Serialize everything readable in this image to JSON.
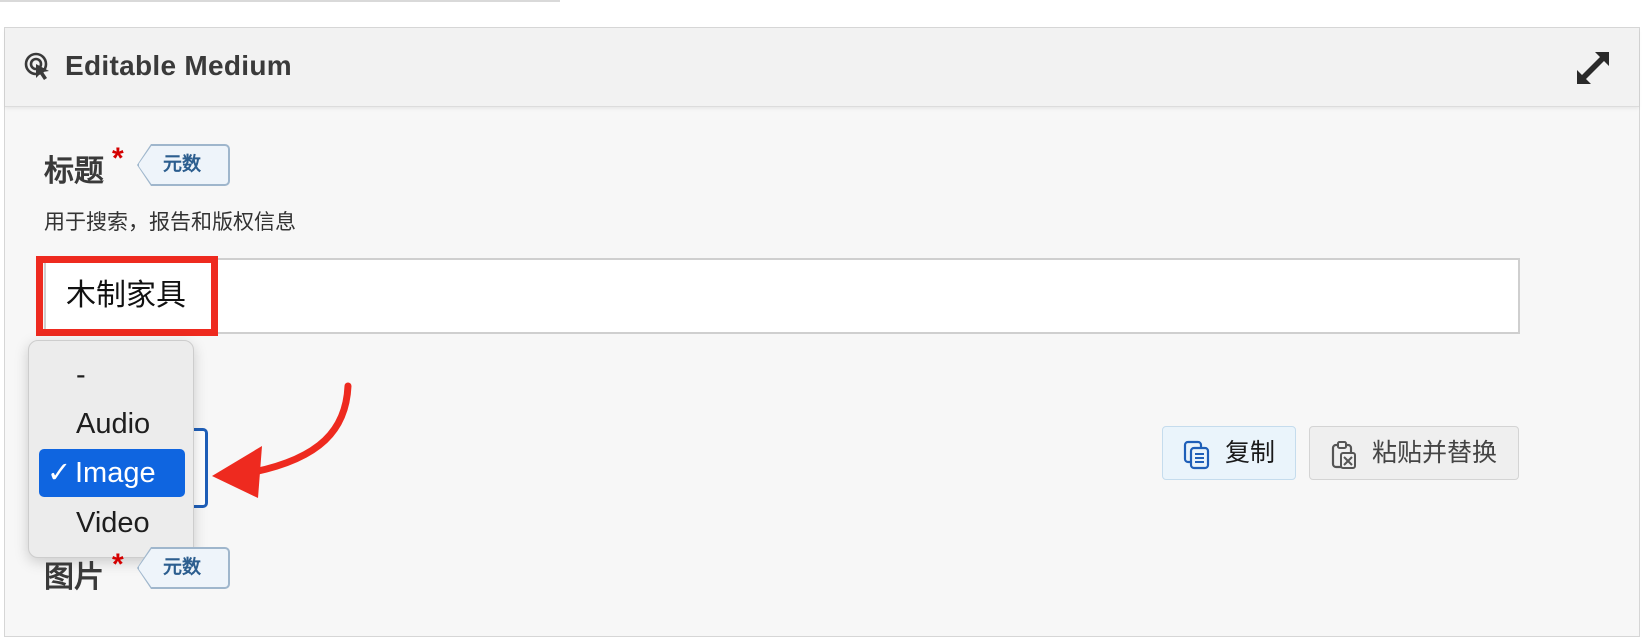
{
  "panel": {
    "title": "Editable Medium",
    "icon": "touch-hand-icon",
    "expand_icon": "expand-arrows-icon"
  },
  "title_field": {
    "label": "标题",
    "required_mark": "*",
    "meta_tag": "元数据",
    "help_text": "用于搜索，报告和版权信息",
    "value": "木制家具"
  },
  "media_type_select": {
    "options": [
      "-",
      "Audio",
      "Image",
      "Video"
    ],
    "selected_index": 2,
    "check_mark": "✓",
    "selected_value": "Image"
  },
  "actions": {
    "copy_label": "复制",
    "copy_icon": "copy-icon",
    "paste_label": "粘贴并替换",
    "paste_icon": "clipboard-paste-icon"
  },
  "image_field": {
    "label": "图片",
    "required_mark": "*",
    "meta_tag": "元数据"
  },
  "colors": {
    "accent_blue": "#0f65e0",
    "highlight_red": "#ee2a1f",
    "required_red": "#d40000"
  }
}
